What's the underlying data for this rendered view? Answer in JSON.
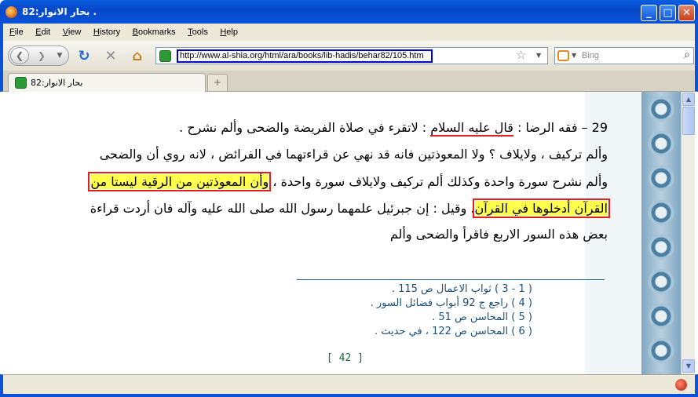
{
  "window": {
    "title": "بحار الانوار:82 .",
    "controls": {
      "minimize": "_",
      "maximize": "□",
      "close": "✕"
    }
  },
  "menu": [
    "File",
    "Edit",
    "View",
    "History",
    "Bookmarks",
    "Tools",
    "Help"
  ],
  "nav": {
    "url": "http://www.al-shia.org/html/ara/books/lib-hadis/behar82/105.htm",
    "search_placeholder": "Bing",
    "icons": [
      "back-icon",
      "forward-icon",
      "reload-icon",
      "stop-icon",
      "home-icon",
      "bookmark-star-icon",
      "search-icon"
    ]
  },
  "tabs": [
    {
      "label": "بحار الانوار:82"
    }
  ],
  "new_tab_label": "+",
  "content": {
    "lines": [
      {
        "pre": "29 – فقه الرضا : ",
        "ul": "قال عليه السلام",
        "post": " : لاتقرء في صلاة الفريضة والضحى وألم نشرح ."
      },
      {
        "pre": "وألم تركيف ، ولايلاف ؟ ولا المعوذتين فانه قد نهي عن قراءتهما في الفرائض ، لانه روي أن والضحى",
        "hl": "",
        "post": ""
      },
      {
        "pre": "وألم نشرح سورة واحدة وكذلك ألم تركيف ولايلاف سورة واحدة ، ",
        "hl": "وأن المعوذتين من الرقية ليستا من",
        "post": ""
      },
      {
        "pre": "",
        "hl": "القرآن أدخلوها في القرآن",
        "post": "، وقيل : إن جبرئيل علمهما رسول الله صلى الله عليه وآله فان أردت قراءة"
      },
      {
        "pre": "بعض هذه السور الاربع فاقرأ والضحى وألم",
        "hl": "",
        "post": ""
      }
    ],
    "footnotes": [
      "( 1 - 3 ) ثواب الاعمال ص 115 .",
      "( 4 ) راجع ج 92 أبواب فضائل السور .",
      "( 5 ) المحاسن ص 51 .",
      "( 6 ) المحاسن ص 122 ، في حديث ."
    ],
    "page_number": "[ 42 ]"
  },
  "colors": {
    "titlebar": "#0a52d8",
    "highlight": "#ffff4d",
    "highlight_border": "#e02020",
    "footnote": "#1a4f7a"
  }
}
